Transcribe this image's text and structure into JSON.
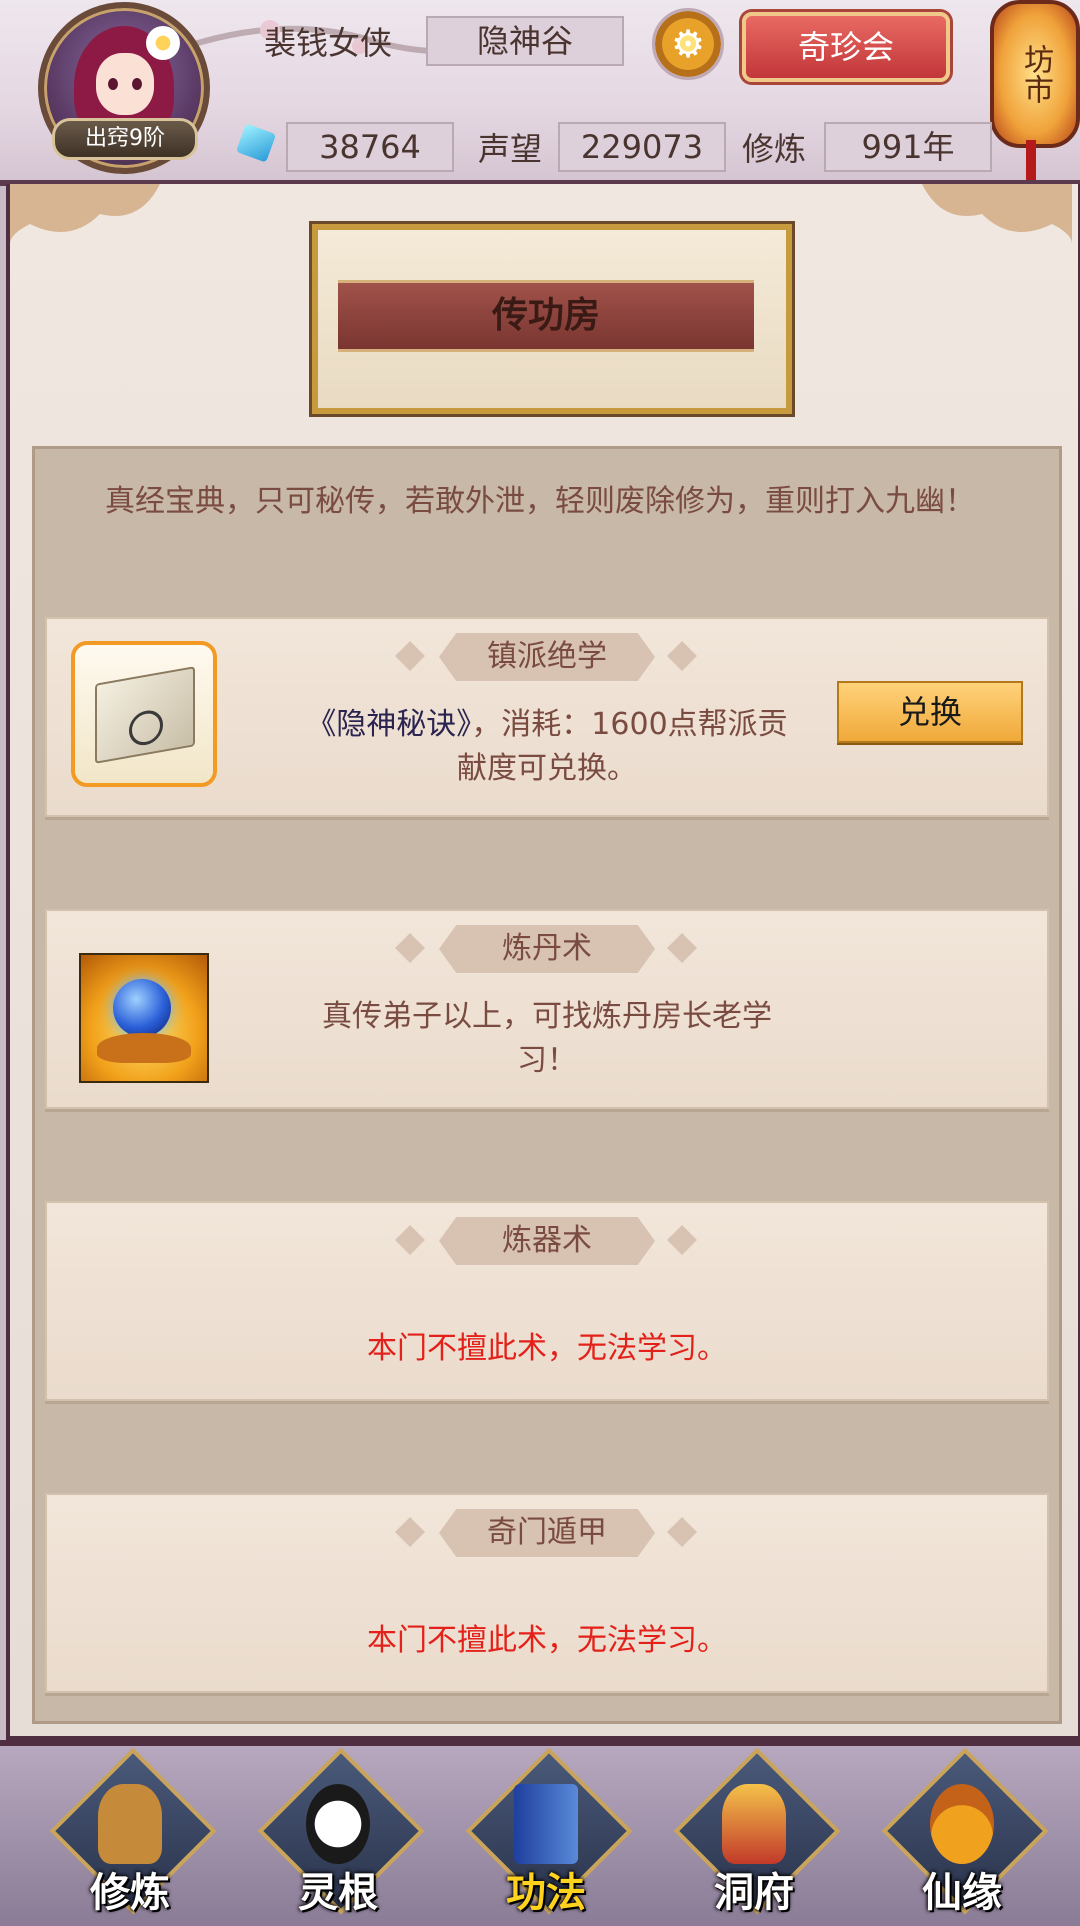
{
  "header": {
    "rank_badge": "出窍9阶",
    "player_name": "裴钱女侠",
    "sect": "隐神谷",
    "shop_button": "奇珍会",
    "market_lantern": "坊市",
    "spirit_stones": "38764",
    "reputation_label": "声望",
    "reputation": "229073",
    "cultivation_label": "修炼",
    "cultivation_years": "991年"
  },
  "page": {
    "title": "传功房",
    "intro": "真经宝典，只可秘传，若敢外泄，轻则废除修为，重则打入九幽！"
  },
  "cards": [
    {
      "title": "镇派绝学",
      "book": "《隐神秘诀》",
      "text": "，消耗：1600点帮派贡献度可兑换。",
      "button": "兑换"
    },
    {
      "title": "炼丹术",
      "text": "真传弟子以上，可找炼丹房长老学习！"
    },
    {
      "title": "炼器术",
      "warning": "本门不擅此术，无法学习。"
    },
    {
      "title": "奇门遁甲",
      "warning": "本门不擅此术，无法学习。"
    }
  ],
  "nav": [
    {
      "label": "修炼",
      "icon": "hooded-monk-icon"
    },
    {
      "label": "灵根",
      "icon": "sword-yinyang-icon"
    },
    {
      "label": "功法",
      "icon": "book-icon",
      "active": true
    },
    {
      "label": "洞府",
      "icon": "pagoda-icon"
    },
    {
      "label": "仙缘",
      "icon": "gourd-icon"
    }
  ],
  "colors": {
    "accent_red": "#e3211a",
    "active_nav": "#ffd21e",
    "shop_button": "#c2363a"
  }
}
